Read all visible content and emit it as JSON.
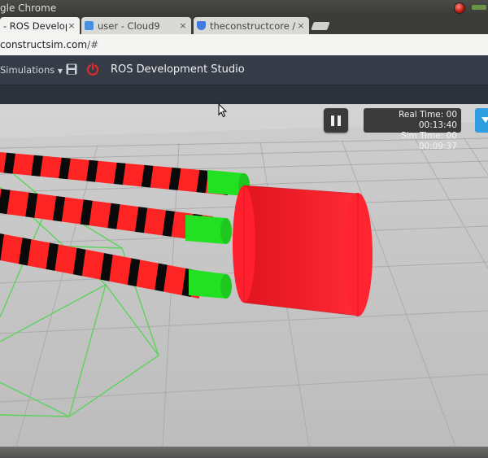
{
  "window": {
    "title": "gle Chrome"
  },
  "tabs": [
    {
      "label": "- ROS Develop",
      "favicon_color": "#3b6dd6",
      "active": true
    },
    {
      "label": "user - Cloud9",
      "favicon_color": "#4a90e2",
      "active": false
    },
    {
      "label": "theconstructcore /",
      "favicon_color": "#3f7be0",
      "active": false
    }
  ],
  "tab_close_glyph": "×",
  "address": {
    "host": "constructsim.com",
    "path": "/#"
  },
  "app_header": {
    "simulations_menu": "Simulations",
    "studio_title": "ROS Development Studio",
    "icons": [
      "save-icon",
      "power-icon"
    ]
  },
  "simulation": {
    "real_time": "Real Time: 00 00:13:40",
    "sim_time": "Sim Time: 00 00:09:37",
    "controls": [
      "pause-icon",
      "chevron-down-icon"
    ]
  },
  "colors": {
    "header_bg": "#353c48",
    "ground": "#cfcfcf",
    "tube_red": "#ff2424",
    "tube_stripe": "#0a0a0a",
    "tube_tip": "#22e022",
    "cylinder": "#ff1f2d",
    "wireframe": "#5cd25c",
    "accent_blue": "#2f9ee0"
  }
}
